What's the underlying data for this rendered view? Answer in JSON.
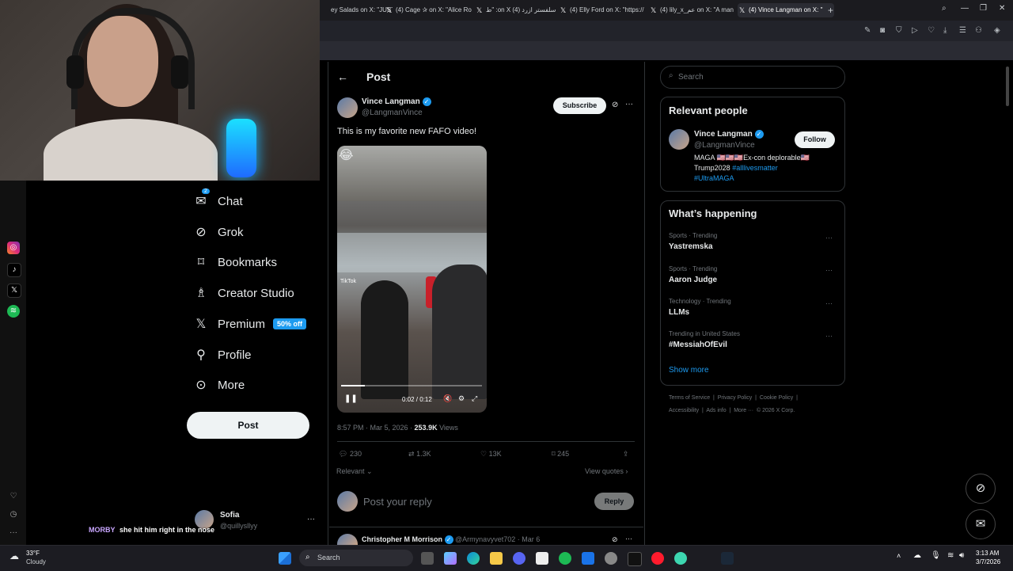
{
  "browser": {
    "tabs": [
      {
        "title": "ey Salads on X: \"JUST"
      },
      {
        "title": "(4) Cage ✰ on X: \"Alice Ro"
      },
      {
        "title": "ط\" :on X سلفستر ازرد (4)"
      },
      {
        "title": "(4) Elly Ford on X: \"https://"
      },
      {
        "title": "(4) lily_x_عم on X: \"A man"
      },
      {
        "title": "(4) Vince Langman on X: \""
      }
    ],
    "new_tab": "+"
  },
  "stream_overlay": {
    "chat_user": "MORBY",
    "chat_message": "she hit him right in the nose"
  },
  "sidebar": {
    "items": [
      {
        "label": "Chat",
        "icon": "chat-icon",
        "badge": "2"
      },
      {
        "label": "Grok",
        "icon": "grok-icon"
      },
      {
        "label": "Bookmarks",
        "icon": "bookmark-icon"
      },
      {
        "label": "Creator Studio",
        "icon": "creator-studio-icon"
      },
      {
        "label": "Premium",
        "icon": "x-logo-icon",
        "badge": "50% off"
      },
      {
        "label": "Profile",
        "icon": "profile-icon"
      },
      {
        "label": "More",
        "icon": "more-circle-icon"
      }
    ],
    "post_label": "Post",
    "account": {
      "name": "Sofia",
      "handle": "@quillysllyy"
    }
  },
  "post": {
    "header_title": "Post",
    "author_name": "Vince Langman",
    "author_handle": "@LangmanVince",
    "subscribe_label": "Subscribe",
    "text": "This is my favorite new FAFO video!",
    "video": {
      "time": "0:02 / 0:12",
      "progress": 0.17,
      "watermark": "TikTok"
    },
    "meta_time": "8:57 PM · Mar 5, 2026 · ",
    "views_count": "253.9K",
    "views_label": " Views",
    "replies": "230",
    "reposts": "1.3K",
    "likes": "13K",
    "bookmarks": "245",
    "sort_label": "Relevant",
    "view_quotes": "View quotes",
    "reply_placeholder": "Post your reply",
    "reply_button": "Reply",
    "next_reply": {
      "name": "Christopher M Morrison",
      "handle": "@Armynavyvet702 · Mar 6"
    }
  },
  "right": {
    "search_placeholder": "Search",
    "relevant_title": "Relevant people",
    "person_name": "Vince Langman",
    "person_handle": "@LangmanVince",
    "follow_label": "Follow",
    "bio_1": "MAGA 🇺🇸🇺🇸🇺🇸Ex-con deplorable🇺🇸",
    "bio_2a": "Trump2028 ",
    "bio_2b": "#alllivesmatter",
    "bio_3": "#UltraMAGA",
    "happening_title": "What’s happening",
    "trends": [
      {
        "context": "Sports · Trending",
        "name": "Yastremska"
      },
      {
        "context": "Sports · Trending",
        "name": "Aaron Judge"
      },
      {
        "context": "Technology · Trending",
        "name": "LLMs"
      },
      {
        "context": "Trending in United States",
        "name": "#MessiahOfEvil"
      }
    ],
    "show_more": "Show more",
    "footer_1": "Terms of Service  |  Privacy Policy  |  Cookie Policy  |",
    "footer_2": "Accessibility  |  Ads info  |  More ···  © 2026 X Corp."
  },
  "taskbar": {
    "weather_temp": "33°F",
    "weather_desc": "Cloudy",
    "search_label": "Search",
    "time": "3:13 AM",
    "date": "3/7/2026"
  },
  "colors": {
    "accent": "#1d9bf0",
    "bg": "#000000",
    "muted": "#71767b"
  }
}
